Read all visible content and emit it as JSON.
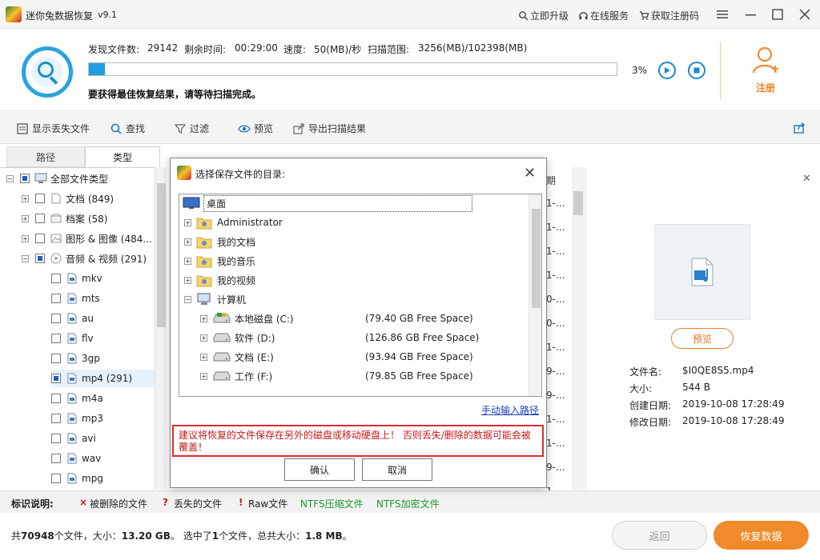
{
  "window": {
    "title": "迷你兔数据恢复",
    "version": "v9.1",
    "links": {
      "upgrade": "立即升级",
      "online_service": "在线服务",
      "get_code": "获取注册码"
    }
  },
  "scan": {
    "found_label": "发现文件数:",
    "found_value": "29142",
    "remaining_label": "剩余时间:",
    "remaining_value": "00:29:00",
    "speed_label": "速度:",
    "speed_value": "50(MB)/秒",
    "range_label": "扫描范围:",
    "range_value": "3256(MB)/102398(MB)",
    "progress_percent": 3,
    "progress_text": "3%",
    "note": "要获得最佳恢复结果，请等待扫描完成。",
    "register_label": "注册"
  },
  "toolbar": {
    "show_lost": "显示丢失文件",
    "search": "查找",
    "filter": "过滤",
    "preview": "预览",
    "export": "导出扫描结果"
  },
  "tabs": {
    "path": "路径",
    "type": "类型"
  },
  "tree": {
    "root": "全部文件类型",
    "items": [
      {
        "label": "文档 (849)"
      },
      {
        "label": "档案 (58)"
      },
      {
        "label": "图形 & 图像 (484..."
      },
      {
        "label": "音频 & 视频 (291)"
      }
    ],
    "subitems": [
      "mkv",
      "mts",
      "au",
      "flv",
      "3gp",
      "mp4 (291)",
      "m4a",
      "mp3",
      "avi",
      "wav",
      "mpg"
    ]
  },
  "list_fragments": {
    "header": "期",
    "rows": [
      "1-...",
      "1-...",
      "1-...",
      "1-...",
      "0-...",
      "0-...",
      "1-...",
      "9-...",
      "9-...",
      "1-...",
      "1-...",
      "9-...",
      "1-..."
    ]
  },
  "preview": {
    "button": "预览",
    "filename_label": "文件名:",
    "filename_value": "$I0QE8S5.mp4",
    "size_label": "大小:",
    "size_value": "544 B",
    "created_label": "创建日期:",
    "created_value": "2019-10-08 17:28:49",
    "modified_label": "修改日期:",
    "modified_value": "2019-10-08 17:28:49"
  },
  "legend": {
    "title": "标识说明:",
    "deleted": "被删除的文件",
    "lost": "丢失的文件",
    "raw": "Raw文件",
    "ntfs_comp": "NTFS压缩文件",
    "ntfs_enc": "NTFS加密文件",
    "x_mark": "×",
    "q_mark": "?",
    "e_mark": "!"
  },
  "footer": {
    "total_pre": "共",
    "total_files": "70948",
    "total_mid": "个文件，大小：",
    "total_size": "13.20 GB",
    "sel_pre": "。 选中了",
    "sel_count": "1",
    "sel_mid": "个文件，总共大小：",
    "sel_size": "1.8 MB",
    "sel_end": "。",
    "back": "返回",
    "recover": "恢复数据"
  },
  "dialog": {
    "title": "选择保存文件的目录:",
    "desktop": "桌面",
    "nodes": [
      "Administrator",
      "我的文档",
      "我的音乐",
      "我的视频",
      "计算机"
    ],
    "drives": [
      {
        "name": "本地磁盘 (C:)",
        "free": "(79.40 GB Free Space)"
      },
      {
        "name": "软件 (D:)",
        "free": "(126.86 GB Free Space)"
      },
      {
        "name": "文档 (E:)",
        "free": "(93.94 GB Free Space)"
      },
      {
        "name": "工作 (F:)",
        "free": "(79.85 GB Free Space)"
      }
    ],
    "manual_input": "手动输入路径",
    "warning": "建议将恢复的文件保存在另外的磁盘或移动硬盘上！ 否则丢失/删除的数据可能会被覆盖！",
    "ok": "确认",
    "cancel": "取消"
  },
  "colors": {
    "accent": "#1e9ee0",
    "orange": "#f08a2a",
    "warning": "#c81818"
  }
}
